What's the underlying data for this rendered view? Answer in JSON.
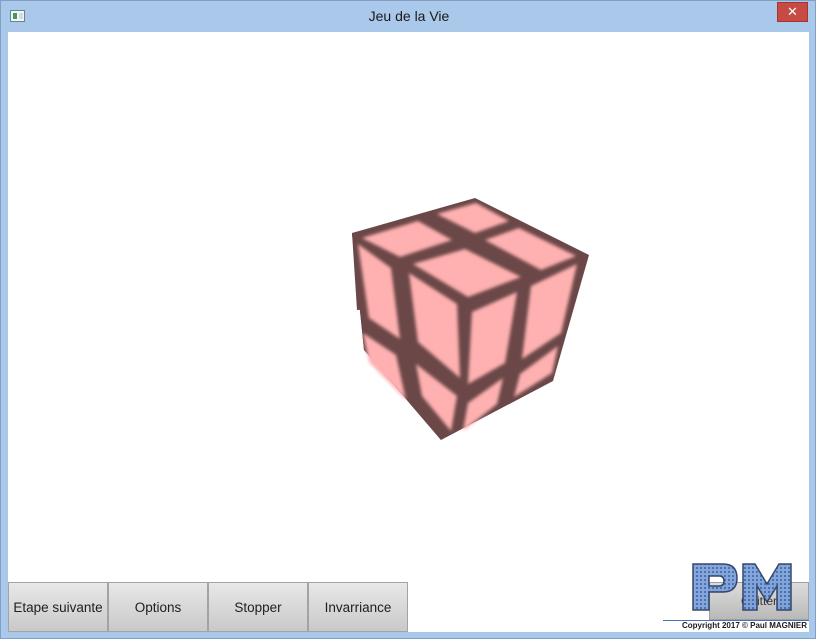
{
  "window": {
    "title": "Jeu de la Vie",
    "close_label": "✕"
  },
  "toolbar": {
    "buttons": [
      {
        "label": "Etape suivante"
      },
      {
        "label": "Options"
      },
      {
        "label": "Stopper"
      },
      {
        "label": "Invarriance"
      }
    ]
  },
  "footer": {
    "logo_text": "PM",
    "hidden_button_label": "Quitter",
    "copyright": "Copyright 2017 © Paul MAGNIER"
  },
  "colors": {
    "cell": "#ffb0b0",
    "border": "#6b4747",
    "accent_close": "#c74b45"
  },
  "icons": [
    "app-icon",
    "close-icon"
  ]
}
